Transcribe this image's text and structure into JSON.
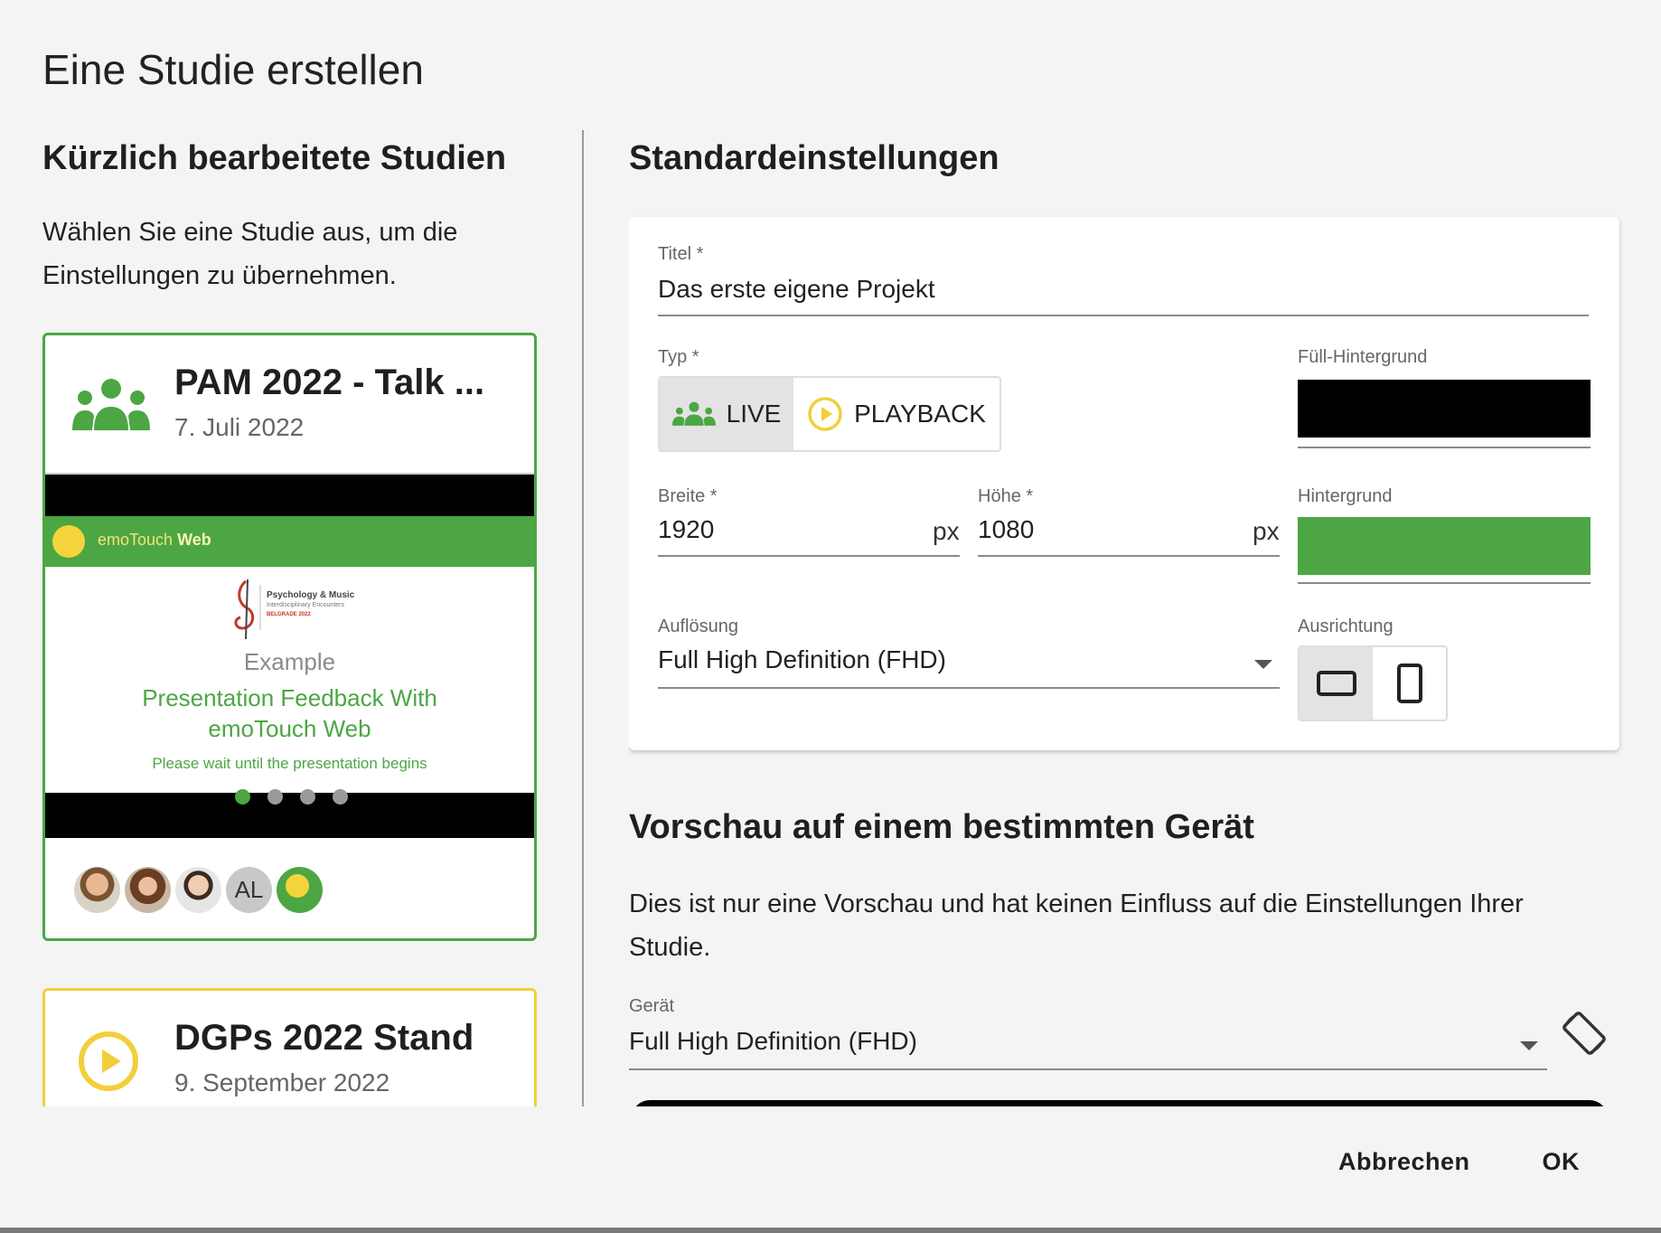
{
  "dialog": {
    "title": "Eine Studie erstellen"
  },
  "recent": {
    "heading": "Kürzlich bearbeitete Studien",
    "description": "Wählen Sie eine Studie aus, um die Einstellungen zu übernehmen.",
    "studies": [
      {
        "title": "PAM 2022 - Talk ...",
        "date": "7. Juli 2022",
        "type_icon": "group-icon",
        "border_color": "#4ca643",
        "preview": {
          "brand": "emoTouch",
          "brand_bold": "Web",
          "logo_title": "Psychology & Music",
          "logo_subtitle": "Interdisciplinary Encounters",
          "logo_city": "BELGRADE 2022",
          "example": "Example",
          "headline_line1": "Presentation Feedback With",
          "headline_line2": "emoTouch Web",
          "wait_text": "Please wait until the presentation begins",
          "slide_count": 4,
          "active_slide": 1
        },
        "avatars": [
          "photo",
          "photo",
          "photo",
          "AL",
          "emotouch-logo"
        ]
      },
      {
        "title": "DGPs 2022 Stand",
        "date": "9. September 2022",
        "type_icon": "play-circle-icon",
        "border_color": "#f2cf3a"
      }
    ]
  },
  "settings": {
    "heading": "Standardeinstellungen",
    "title_label": "Titel *",
    "title_value": "Das erste eigene Projekt",
    "type_label": "Typ *",
    "type_options": [
      "LIVE",
      "PLAYBACK"
    ],
    "type_selected": "LIVE",
    "fill_bg_label": "Füll-Hintergrund",
    "fill_bg_color": "#000000",
    "width_label": "Breite *",
    "width_value": "1920",
    "height_label": "Höhe *",
    "height_value": "1080",
    "unit": "px",
    "bg_label": "Hintergrund",
    "bg_color": "#4ca643",
    "resolution_label": "Auflösung",
    "resolution_value": "Full High Definition (FHD)",
    "orientation_label": "Ausrichtung",
    "orientation_options": [
      "landscape-icon",
      "portrait-icon"
    ],
    "orientation_selected": "landscape-icon"
  },
  "device_preview": {
    "heading": "Vorschau auf einem bestimmten Gerät",
    "description": "Dies ist nur eine Vorschau und hat keinen Einfluss auf die Einstellungen Ihrer Studie.",
    "device_label": "Gerät",
    "device_value": "Full High Definition (FHD)"
  },
  "actions": {
    "cancel": "Abbrechen",
    "ok": "OK"
  },
  "colors": {
    "accent_green": "#4ca643",
    "accent_yellow": "#f2cf3a"
  }
}
